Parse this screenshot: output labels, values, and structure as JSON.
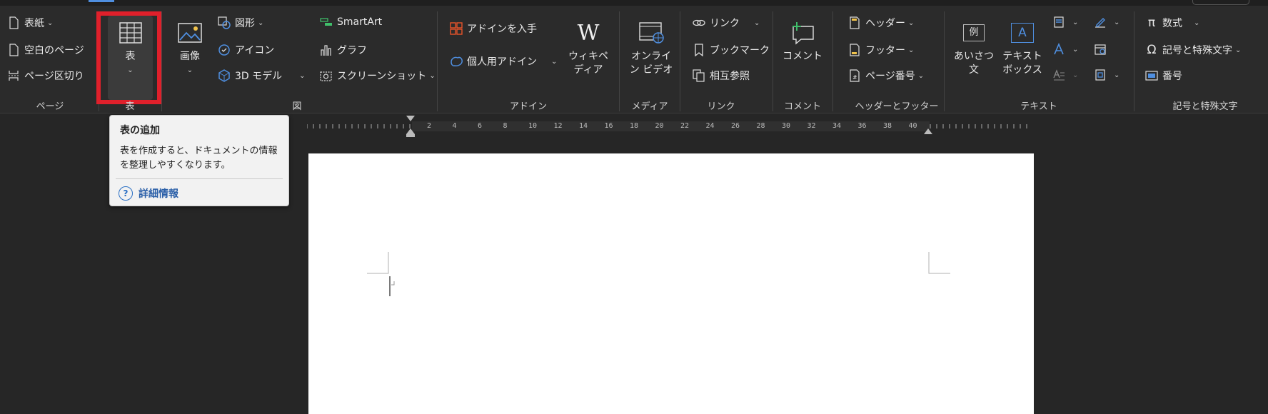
{
  "ribbon": {
    "page_group": {
      "label": "ページ",
      "items": [
        "表紙",
        "空白のページ",
        "ページ区切り"
      ]
    },
    "table_group": {
      "label": "表",
      "button_label": "表"
    },
    "illustrations_group": {
      "label": "図",
      "image_label": "画像",
      "items": [
        "図形",
        "アイコン",
        "3D モデル",
        "SmartArt",
        "グラフ",
        "スクリーンショット"
      ]
    },
    "addins_group": {
      "label": "アドイン",
      "get_addins": "アドインを入手",
      "my_addins": "個人用アドイン",
      "wikipedia_line1": "ウィキペ",
      "wikipedia_line2": "ディア"
    },
    "media_group": {
      "label": "メディア",
      "online_video_line1": "オンライ",
      "online_video_line2": "ン ビデオ"
    },
    "links_group": {
      "label": "リンク",
      "items": [
        "リンク",
        "ブックマーク",
        "相互参照"
      ]
    },
    "comments_group": {
      "label": "コメント",
      "comment_label": "コメント"
    },
    "header_footer_group": {
      "label": "ヘッダーとフッター",
      "items": [
        "ヘッダー",
        "フッター",
        "ページ番号"
      ]
    },
    "text_group": {
      "label": "テキスト",
      "greeting_line1": "あいさつ",
      "greeting_line2": "文",
      "textbox_line1": "テキスト",
      "textbox_line2": "ボックス"
    },
    "symbols_group": {
      "label": "記号と特殊文字",
      "items": [
        "数式",
        "記号と特殊文字",
        "番号"
      ]
    }
  },
  "tooltip": {
    "title": "表の追加",
    "body": "表を作成すると、ドキュメントの情報を整理しやすくなります。",
    "link": "詳細情報"
  },
  "icons": {
    "example_box": "例",
    "textbox_letter": "A",
    "wiki_letter": "W",
    "pi_symbol": "π",
    "omega_symbol": "Ω"
  },
  "ruler": {
    "labels": [
      "2",
      "4",
      "6",
      "8",
      "10",
      "12",
      "14",
      "16",
      "18",
      "20",
      "22",
      "24",
      "26",
      "28",
      "30",
      "32",
      "34",
      "36",
      "38",
      "40"
    ]
  },
  "colors": {
    "background": "#262626",
    "ribbon": "#2b2b2b",
    "highlight_border": "#e0202b",
    "accent_blue": "#4f8fe0",
    "addin_orange": "#e8542a",
    "link_blue": "#2a5fa8"
  }
}
